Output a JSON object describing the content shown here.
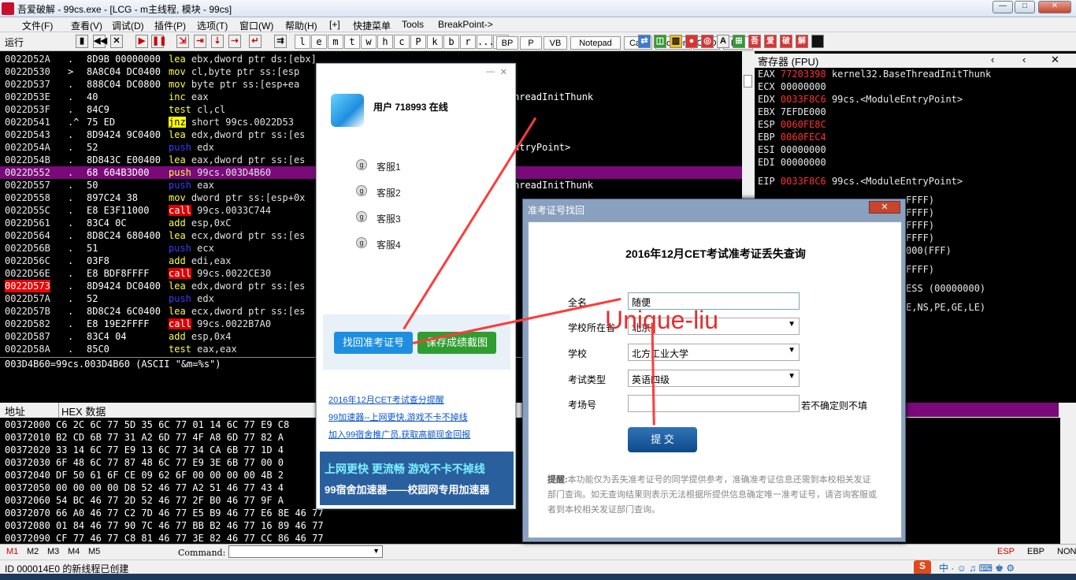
{
  "window": {
    "title": "吾爱破解 - 99cs.exe - [LCG - m主线程, 模块 - 99cs]"
  },
  "menu": [
    "文件(F)",
    "查看(V)",
    "调试(D)",
    "插件(P)",
    "选项(T)",
    "窗口(W)",
    "帮助(H)",
    "[+]",
    "快捷菜单",
    "Tools",
    "BreakPoint->"
  ],
  "toolbar": {
    "run_label": "运行",
    "letter_buttons": [
      "l",
      "e",
      "m",
      "t",
      "w",
      "h",
      "c",
      "P",
      "k",
      "b",
      "r",
      "...",
      "s"
    ],
    "named_buttons": [
      "BP",
      "P",
      "VB",
      "Notepad",
      "Calc",
      "Folder",
      "CMD",
      "Exit"
    ]
  },
  "disasm": [
    {
      "addr": "0022D52A",
      "mk": ".",
      "hex": "8D9B 00000000",
      "asm": "lea ebx,dword ptr ds:[ebx]",
      "style": ""
    },
    {
      "addr": "0022D530",
      "mk": ">",
      "hex": "8A8C04 DC0400",
      "asm": "mov cl,byte ptr ss:[esp",
      "style": ""
    },
    {
      "addr": "0022D537",
      "mk": ".",
      "hex": "888C04 DC0800",
      "asm": "mov byte ptr ss:[esp+ea",
      "style": ""
    },
    {
      "addr": "0022D53E",
      "mk": ".",
      "hex": "40",
      "asm": "inc eax",
      "style": ""
    },
    {
      "addr": "0022D53F",
      "mk": ".",
      "hex": "84C9",
      "asm": "test cl,cl",
      "style": ""
    },
    {
      "addr": "0022D541",
      "mk": ".^",
      "hex": "75 ED",
      "asm": "jnz short 99cs.0022D53",
      "style": "y"
    },
    {
      "addr": "0022D543",
      "mk": ".",
      "hex": "8D9424 9C0400",
      "asm": "lea edx,dword ptr ss:[es",
      "style": ""
    },
    {
      "addr": "0022D54A",
      "mk": ".",
      "hex": "52",
      "asm": "push edx",
      "style": "b"
    },
    {
      "addr": "0022D54B",
      "mk": ".",
      "hex": "8D843C E00400",
      "asm": "lea eax,dword ptr ss:[es",
      "style": ""
    },
    {
      "addr": "0022D552",
      "mk": ".",
      "hex": "68 604B3D00",
      "asm": "push 99cs.003D4B60",
      "style": "sel"
    },
    {
      "addr": "0022D557",
      "mk": ".",
      "hex": "50",
      "asm": "push eax",
      "style": "b"
    },
    {
      "addr": "0022D558",
      "mk": ".",
      "hex": "897C24 38",
      "asm": "mov dword ptr ss:[esp+0x",
      "style": ""
    },
    {
      "addr": "0022D55C",
      "mk": ".",
      "hex": "E8 E3F11000",
      "asm": "call 99cs.0033C744",
      "style": "r"
    },
    {
      "addr": "0022D561",
      "mk": ".",
      "hex": "83C4 0C",
      "asm": "add esp,0xC",
      "style": ""
    },
    {
      "addr": "0022D564",
      "mk": ".",
      "hex": "8D8C24 680400",
      "asm": "lea ecx,dword ptr ss:[es",
      "style": ""
    },
    {
      "addr": "0022D56B",
      "mk": ".",
      "hex": "51",
      "asm": "push ecx",
      "style": "b"
    },
    {
      "addr": "0022D56C",
      "mk": ".",
      "hex": "03F8",
      "asm": "add edi,eax",
      "style": ""
    },
    {
      "addr": "0022D56E",
      "mk": ".",
      "hex": "E8 BDF8FFFF",
      "asm": "call 99cs.0022CE30",
      "style": "r"
    },
    {
      "addr": "0022D573",
      "mk": ".",
      "hex": "8D9424 DC0400",
      "asm": "lea edx,dword ptr ss:[es",
      "style": "bp"
    },
    {
      "addr": "0022D57A",
      "mk": ".",
      "hex": "52",
      "asm": "push edx",
      "style": "b"
    },
    {
      "addr": "0022D57B",
      "mk": ".",
      "hex": "8D8C24 6C0400",
      "asm": "lea ecx,dword ptr ss:[es",
      "style": ""
    },
    {
      "addr": "0022D582",
      "mk": ".",
      "hex": "E8 19E2FFFF",
      "asm": "call 99cs.0022B7A0",
      "style": "r"
    },
    {
      "addr": "0022D587",
      "mk": ".",
      "hex": "83C4 04",
      "asm": "add esp,0x4",
      "style": ""
    },
    {
      "addr": "0022D58A",
      "mk": ".",
      "hex": "85C0",
      "asm": "test eax,eax",
      "style": ""
    }
  ],
  "disasm_right_frag": [
    "hreadInitThunk",
    "ntryPoint>",
    "hreadInitThunk"
  ],
  "info_line": "003D4B60=99cs.003D4B60 (ASCII \"&m=%s\")",
  "registers": {
    "header": "寄存器 (FPU)",
    "rows": [
      {
        "name": "EAX",
        "val": "77203398",
        "red": true,
        "note": "kernel32.BaseThreadInitThunk"
      },
      {
        "name": "ECX",
        "val": "00000000",
        "red": false,
        "note": ""
      },
      {
        "name": "EDX",
        "val": "0033F8C6",
        "red": true,
        "note": "99cs.<ModuleEntryPoint>"
      },
      {
        "name": "EBX",
        "val": "7EFDE000",
        "red": false,
        "note": ""
      },
      {
        "name": "ESP",
        "val": "0060FE8C",
        "red": true,
        "note": ""
      },
      {
        "name": "EBP",
        "val": "0060FEC4",
        "red": true,
        "note": ""
      },
      {
        "name": "ESI",
        "val": "00000000",
        "red": false,
        "note": ""
      },
      {
        "name": "EDI",
        "val": "00000000",
        "red": false,
        "note": ""
      }
    ],
    "eip": {
      "name": "EIP",
      "val": "0033F8C6",
      "note": "99cs.<ModuleEntryPoint>"
    },
    "frag": [
      "FFFF)",
      "FFFF)",
      "FFFF)",
      "FFFF)",
      "000(FFF)",
      "FFFF)",
      "ESS (00000000)",
      "E,NS,PE,GE,LE)"
    ]
  },
  "dump": {
    "header_addr": "地址",
    "header_hex": "HEX 数据",
    "rows": [
      "00372000 C6 2C 6C 77 5D 35 6C 77 01 14 6C 77 E9 C8",
      "00372010 B2 CD 6B 77 31 A2 6D 77 4F A8 6D 77 82 A",
      "00372020 33 14 6C 77 E9 13 6C 77 34 CA 6B 77 1D 4",
      "00372030 6F 48 6C 77 87 48 6C 77 E9 3E 6B 77 00 0",
      "00372040 DF 50 61 6F CE 09 62 6F 00 00 00 00 4B 2",
      "00372050 00 00 00 00 D8 52 46 77 A2 51 46 77 43 4",
      "00372060 54 BC 46 77 2D 52 46 77 2F B0 46 77 9F A",
      "00372070 66 A0 46 77 C2 7D 46 77 E5 B9 46 77 E6 8E 46 77",
      "00372080 01 84 46 77 90 7C 46 77 BB B2 46 77 16 89 46 77",
      "00372090 CF 77 46 77 C8 81 46 77 3E 82 46 77 CC 86 46 77"
    ]
  },
  "statusbar": {
    "tabs": [
      "M1",
      "M2",
      "M3",
      "M4",
      "M5"
    ],
    "command_label": "Command:",
    "right": [
      "ESP",
      "EBP",
      "NONE"
    ]
  },
  "idline": "ID 000014E0 的新线程已创建",
  "chat": {
    "user": "用户 718993 在线",
    "services": [
      "客服1",
      "客服2",
      "客服3",
      "客服4"
    ],
    "btn_find": "找回准考证号",
    "btn_save": "保存成绩截图",
    "links": [
      "2016年12月CET考试查分提醒",
      "99加速器--上网更快,游戏不卡不掉线",
      "加入99宿舍推广员,获取高额现金回报"
    ],
    "banner_line1": "上网更快 更流畅 游戏不卡不掉线",
    "banner_line2": "99宿舍加速器——校园网专用加速器"
  },
  "dialog": {
    "title": "准考证号找回",
    "heading": "2016年12月CET考试准考证丢失查询",
    "fields": [
      {
        "label": "全名",
        "value": "随便",
        "type": "input"
      },
      {
        "label": "学校所在省",
        "value": "北京",
        "type": "select"
      },
      {
        "label": "学校",
        "value": "北方工业大学",
        "type": "select"
      },
      {
        "label": "考试类型",
        "value": "英语四级",
        "type": "select"
      },
      {
        "label": "考场号",
        "value": "",
        "type": "input"
      }
    ],
    "hint_beside": "若不确定则不填",
    "submit": "提 交",
    "notice_label": "提醒:",
    "notice": "本功能仅为丢失准考证号的同学提供参考，准确准考证信息还需到本校相关发证部门查询。如无查询结果则表示无法根据所提供信息确定唯一准考证号，请咨询客服或者到本校相关发证部门查询。"
  },
  "watermark": "Unique-liu",
  "colors": {
    "accent": "#1e8fe0",
    "annotation": "#ff3b3b",
    "selection": "#7a0a7a"
  }
}
